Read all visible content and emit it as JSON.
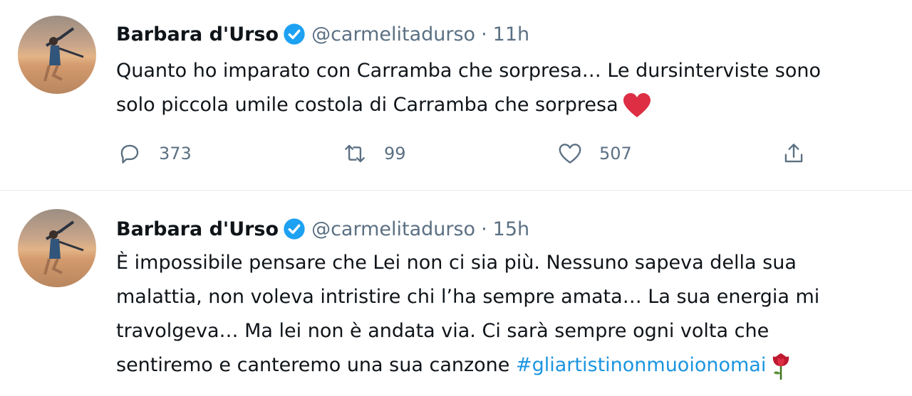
{
  "tweets": [
    {
      "name": "Barbara d'Urso",
      "handle": "@carmelitadurso",
      "separator": "·",
      "time": "11h",
      "lines": [
        "Quanto ho imparato con Carramba che sorpresa… Le dursinterviste sono",
        "solo piccola umile costola di Carramba che sorpresa"
      ],
      "emoji": "red-heart",
      "replies": "373",
      "retweets": "99",
      "likes": "507"
    },
    {
      "name": "Barbara d'Urso",
      "handle": "@carmelitadurso",
      "separator": "·",
      "time": "15h",
      "lines": [
        "È impossibile pensare che Lei non ci sia più. Nessuno sapeva della sua",
        "malattia, non voleva intristire chi l’ha sempre amata… La sua energia mi",
        "travolgeva… Ma lei non è andata via. Ci sarà sempre ogni volta che",
        "sentiremo e canteremo una sua canzone"
      ],
      "hashtag": "#gliartistinonmuoionomai",
      "emoji": "rose"
    }
  ],
  "colors": {
    "text": "#0f1419",
    "secondary": "#5b7083",
    "link": "#1b95e0",
    "verified": "#1da1f2",
    "divider": "#e6ecf0"
  }
}
